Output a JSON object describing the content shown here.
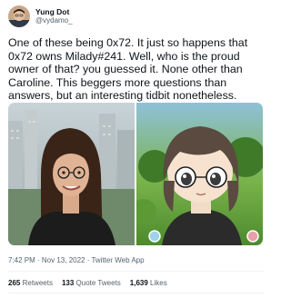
{
  "author": {
    "display_name": "Yung Dot",
    "handle": "@vydamo_",
    "avatar_icon": "profile-photo"
  },
  "tweet": {
    "text": "One of these being 0x72. It just so happens that 0x72 owns Milady#241. Well, who is the proud owner of that? you guessed it. None other than Caroline. This beggers more questions than answers, but an interesting tidbit nonetheless.",
    "timestamp": "7:42 PM · Nov 13, 2022 · Twitter Web App"
  },
  "media": {
    "left_image": "photo-of-person",
    "right_image": "anime-avatar-milady"
  },
  "stats": {
    "retweets_count": "265",
    "retweets_label": "Retweets",
    "quotes_count": "133",
    "quotes_label": "Quote Tweets",
    "likes_count": "1,639",
    "likes_label": "Likes"
  }
}
